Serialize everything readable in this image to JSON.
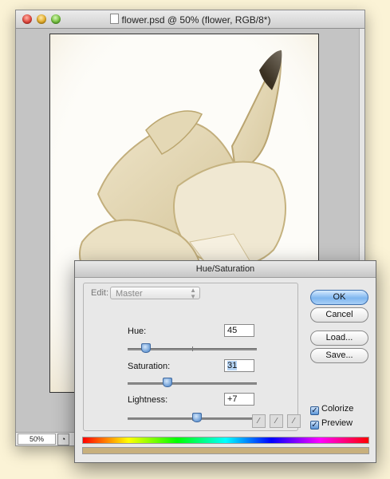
{
  "document": {
    "title": "flower.psd @ 50% (flower, RGB/8*)",
    "zoom": "50%",
    "status_icon": "document-info-icon"
  },
  "dialog": {
    "title": "Hue/Saturation",
    "edit_label": "Edit:",
    "edit_value": "Master",
    "hue": {
      "label": "Hue:",
      "value": "45",
      "slider_fraction": 0.14
    },
    "saturation": {
      "label": "Saturation:",
      "value": "31",
      "slider_fraction": 0.31
    },
    "lightness": {
      "label": "Lightness:",
      "value": "+7",
      "slider_fraction": 0.535
    },
    "buttons": {
      "ok": "OK",
      "cancel": "Cancel",
      "load": "Load...",
      "save": "Save..."
    },
    "colorize_label": "Colorize",
    "colorize_checked": true,
    "preview_label": "Preview",
    "preview_checked": true,
    "eyedroppers": [
      "eyedropper-icon",
      "eyedropper-plus-icon",
      "eyedropper-minus-icon"
    ],
    "colorize_tint": "#c8b07d"
  }
}
